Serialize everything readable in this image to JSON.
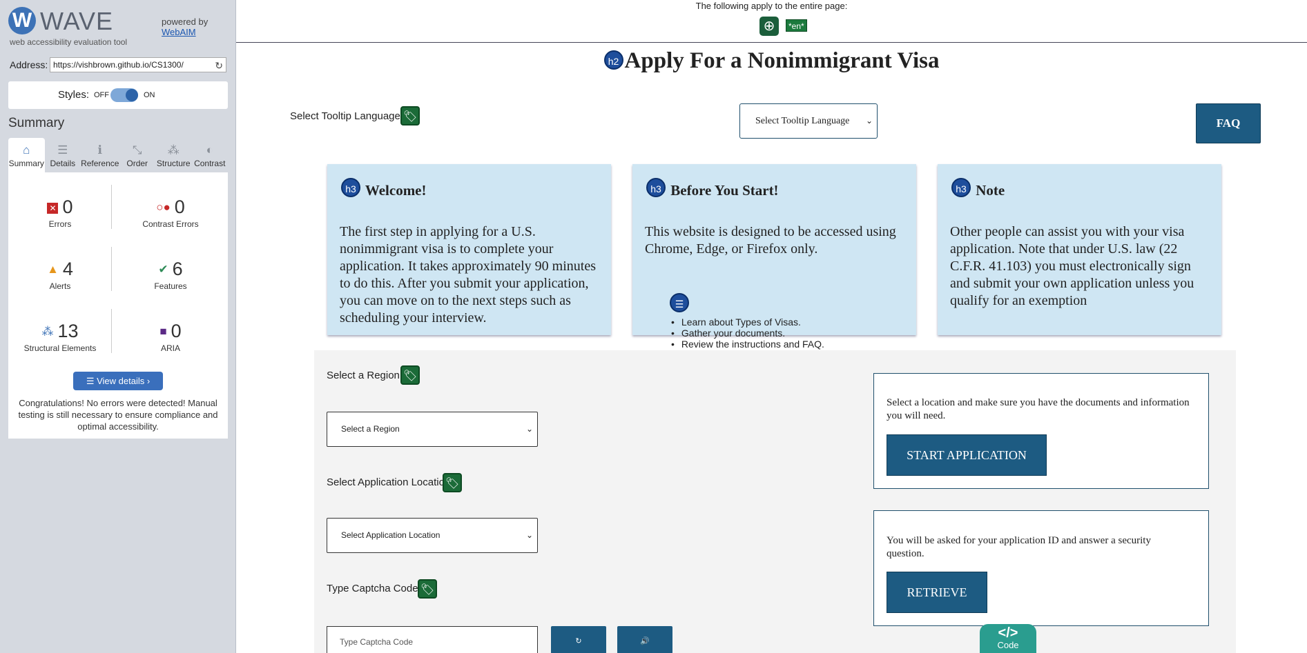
{
  "wave": {
    "logo_letter": "W",
    "title": "WAVE",
    "subtitle": "web accessibility evaluation tool",
    "powered_by": "powered by",
    "webaim": "WebAIM",
    "address_label": "Address:",
    "address_value": "https://vishbrown.github.io/CS1300/",
    "styles_label": "Styles:",
    "styles_off": "OFF",
    "styles_on": "ON",
    "summary_heading": "Summary",
    "tabs": [
      {
        "label": "Summary",
        "icon": "home-icon",
        "glyph": "⌂"
      },
      {
        "label": "Details",
        "icon": "list-icon",
        "glyph": "☰"
      },
      {
        "label": "Reference",
        "icon": "info-icon",
        "glyph": "ℹ"
      },
      {
        "label": "Order",
        "icon": "order-icon",
        "glyph": "⤡"
      },
      {
        "label": "Structure",
        "icon": "structure-icon",
        "glyph": "⁂"
      },
      {
        "label": "Contrast",
        "icon": "contrast-icon",
        "glyph": "◐"
      }
    ],
    "stats": {
      "errors": {
        "count": "0",
        "label": "Errors"
      },
      "contrast_errors": {
        "count": "0",
        "label": "Contrast Errors"
      },
      "alerts": {
        "count": "4",
        "label": "Alerts"
      },
      "features": {
        "count": "6",
        "label": "Features"
      },
      "structural": {
        "count": "13",
        "label": "Structural Elements"
      },
      "aria": {
        "count": "0",
        "label": "ARIA"
      }
    },
    "view_details": "View details ›",
    "congrats": "Congratulations! No errors were detected! Manual testing is still necessary to ensure compliance and optimal accessibility."
  },
  "page": {
    "top_notice": "The following apply to the entire page:",
    "lang_badge": "*en*",
    "heading_icon": "h2",
    "heading": "Apply For a Nonimmigrant Visa",
    "tooltip_label": "Select Tooltip Language",
    "tooltip_select": "Select Tooltip Language",
    "faq": "FAQ",
    "cards": [
      {
        "tag": "h3",
        "title": "Welcome!",
        "body": "The first step in applying for a U.S. nonimmigrant visa is to complete your application. It takes approximately 90 minutes to do this. After you submit your application, you can move on to the next steps such as scheduling your interview."
      },
      {
        "tag": "h3",
        "title": "Before You Start!",
        "body": "This website is designed to be accessed using Chrome, Edge, or Firefox only."
      },
      {
        "tag": "h3",
        "title": "Note",
        "body": "Other people can assist you with your visa application. Note that under U.S. law (22 C.F.R. 41.103) you must electronically sign and submit your own application unless you qualify for an exemption"
      }
    ],
    "list_items": [
      "Learn about Types of Visas.",
      "Gather your documents.",
      "Review the instructions and FAQ."
    ],
    "region_label": "Select a Region",
    "region_select": "Select a Region",
    "location_label": "Select Application Location",
    "location_select": "Select Application Location",
    "captcha_label": "Type Captcha Code",
    "captcha_placeholder": "Type Captcha Code",
    "start_text": "Select a location and make sure you have the documents and information you will need.",
    "start_button": "START APPLICATION",
    "retrieve_text": "You will be asked for your application ID and answer a security question.",
    "retrieve_button": "RETRIEVE",
    "code_toggle_glyph": "</>",
    "code_toggle_label": "Code"
  }
}
